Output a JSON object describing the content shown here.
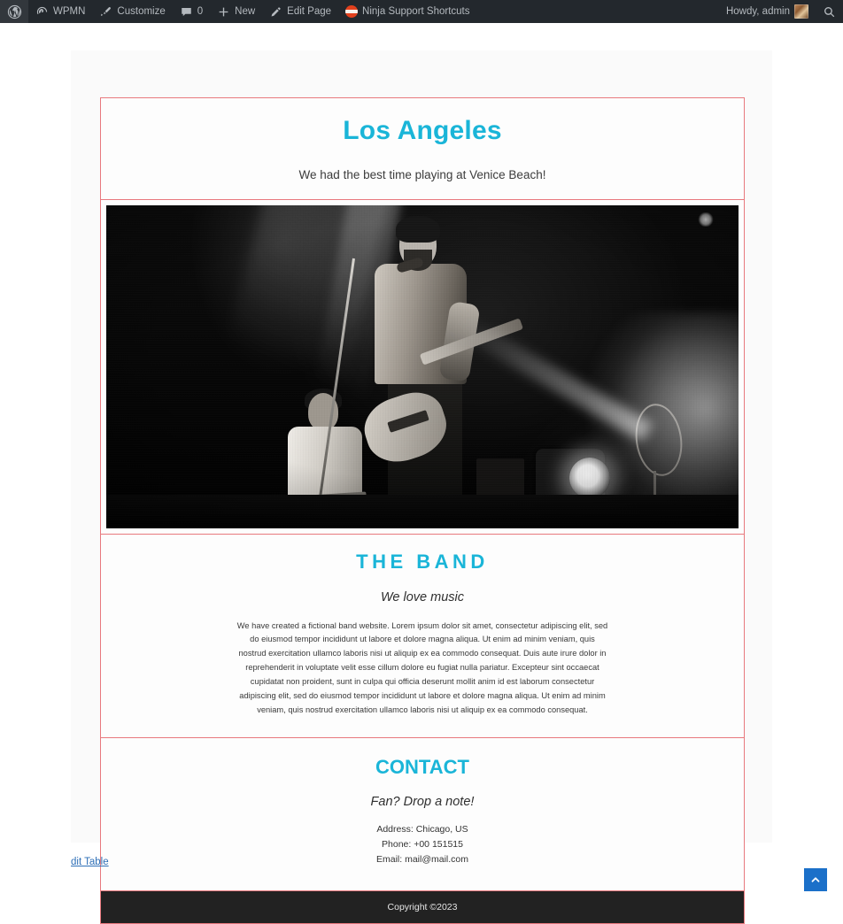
{
  "adminbar": {
    "wp_logo": "wordpress-logo",
    "items": [
      {
        "label": "WPMN",
        "icon": "dashboard-icon"
      },
      {
        "label": "Customize",
        "icon": "paintbrush-icon"
      },
      {
        "label": "0",
        "icon": "comment-bubble-icon"
      },
      {
        "label": "New",
        "icon": "plus-icon"
      },
      {
        "label": "Edit Page",
        "icon": "pencil-icon"
      },
      {
        "label": "Ninja Support Shortcuts",
        "icon": "ninja-icon"
      }
    ],
    "howdy": "Howdy, admin",
    "avatar": "user-avatar",
    "search": "search-icon"
  },
  "site": {
    "header": {
      "title": "Los Angeles",
      "tagline": "We had the best time playing at Venice Beach!"
    },
    "hero": {
      "alt": "Black and white photo of a band performing live on stage"
    },
    "band": {
      "heading": "THE BAND",
      "subheading": "We love music",
      "paragraph": "We have created a fictional band website. Lorem ipsum dolor sit amet, consectetur adipiscing elit, sed do eiusmod tempor incididunt ut labore et dolore magna aliqua. Ut enim ad minim veniam, quis nostrud exercitation ullamco laboris nisi ut aliquip ex ea commodo consequat. Duis aute irure dolor in reprehenderit in voluptate velit esse cillum dolore eu fugiat nulla pariatur. Excepteur sint occaecat cupidatat non proident, sunt in culpa qui officia deserunt mollit anim id est laborum consectetur adipiscing elit, sed do eiusmod tempor incididunt ut labore et dolore magna aliqua. Ut enim ad minim veniam, quis nostrud exercitation ullamco laboris nisi ut aliquip ex ea commodo consequat."
    },
    "contact": {
      "heading": "CONTACT",
      "subheading": "Fan? Drop a note!",
      "address": "Address: Chicago, US",
      "phone": "Phone: +00 151515",
      "email": "Email: mail@mail.com"
    },
    "footer": {
      "copyright": "Copyright ©2023"
    }
  },
  "page": {
    "edit_link": "dit Table",
    "scroll_top_icon": "chevron-up-icon"
  },
  "colors": {
    "accent_cyan": "#1ab5d8",
    "frame_border": "#e8797e",
    "adminbar_bg": "#23282d",
    "footer_bg": "#222222",
    "link_blue": "#2e6fb7",
    "scroll_button": "#1b70c9"
  }
}
